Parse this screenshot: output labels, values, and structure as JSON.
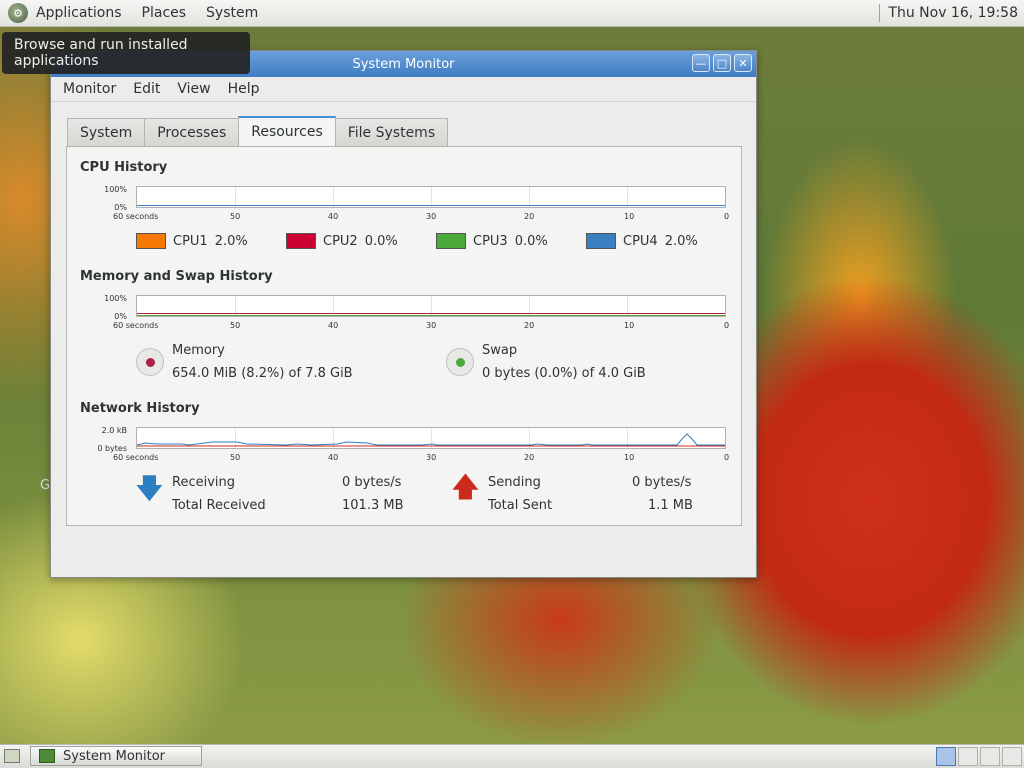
{
  "top_panel": {
    "menus": [
      "Applications",
      "Places",
      "System"
    ],
    "clock": "Thu Nov 16, 19:58"
  },
  "tooltip": "Browse and run installed applications",
  "desktop_fragment": "G",
  "window": {
    "title": "System Monitor",
    "controls": [
      "minimize",
      "maximize",
      "close"
    ],
    "menu": [
      "Monitor",
      "Edit",
      "View",
      "Help"
    ],
    "tabs": [
      "System",
      "Processes",
      "Resources",
      "File Systems"
    ],
    "active_tab": "Resources"
  },
  "cpu": {
    "title": "CPU History",
    "y_top": "100%",
    "y_bottom": "0%",
    "x_labels": [
      "60 seconds",
      "50",
      "40",
      "30",
      "20",
      "10",
      "0"
    ],
    "legend": [
      {
        "name": "CPU1",
        "value": "2.0%",
        "color": "#f57900"
      },
      {
        "name": "CPU2",
        "value": "0.0%",
        "color": "#cc0033"
      },
      {
        "name": "CPU3",
        "value": "0.0%",
        "color": "#4aa93a"
      },
      {
        "name": "CPU4",
        "value": "2.0%",
        "color": "#3a7fbf"
      }
    ]
  },
  "memory": {
    "title": "Memory and Swap History",
    "y_top": "100%",
    "y_bottom": "0%",
    "x_labels": [
      "60 seconds",
      "50",
      "40",
      "30",
      "20",
      "10",
      "0"
    ],
    "mem_label": "Memory",
    "mem_value": "654.0 MiB (8.2%) of 7.8 GiB",
    "mem_color": "#ad1f45",
    "swap_label": "Swap",
    "swap_value": "0 bytes (0.0%) of 4.0 GiB",
    "swap_color": "#4aa93a"
  },
  "network": {
    "title": "Network History",
    "y_top": "2.0 kB",
    "y_bottom": "0 bytes",
    "x_labels": [
      "60 seconds",
      "50",
      "40",
      "30",
      "20",
      "10",
      "0"
    ],
    "receiving_label": "Receiving",
    "receiving_value": "0 bytes/s",
    "total_received_label": "Total Received",
    "total_received_value": "101.3 MB",
    "sending_label": "Sending",
    "sending_value": "0 bytes/s",
    "total_sent_label": "Total Sent",
    "total_sent_value": "1.1 MB",
    "receive_color": "#2d7fc1",
    "send_color": "#cc2a1a"
  },
  "taskbar": {
    "task_label": "System Monitor"
  }
}
